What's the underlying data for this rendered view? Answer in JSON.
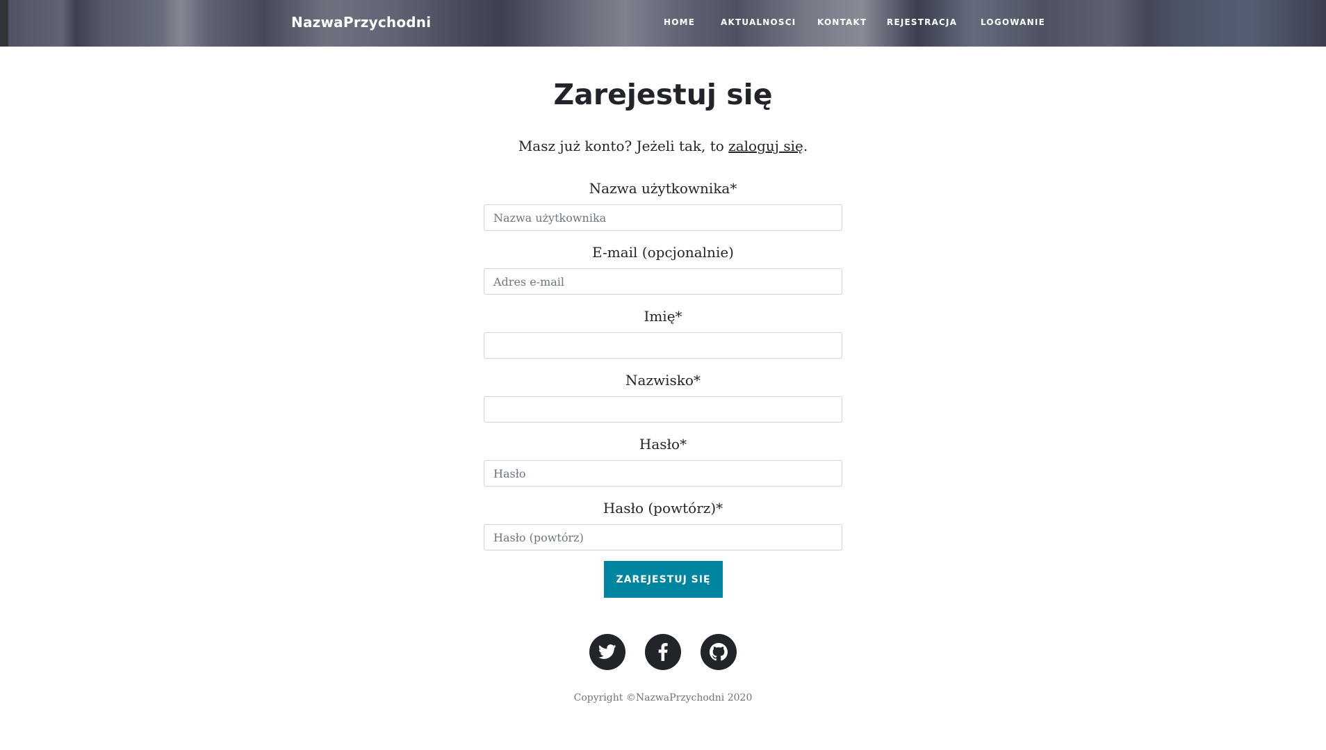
{
  "header": {
    "brand": "NazwaPrzychodni",
    "nav": [
      {
        "label": "HOME"
      },
      {
        "label": "AKTUALNOSCI"
      },
      {
        "label": "KONTAKT"
      },
      {
        "label": "REJESTRACJA"
      },
      {
        "label": "LOGOWANIE"
      }
    ]
  },
  "main": {
    "title": "Zarejestuj się",
    "subtitle_prefix": "Masz już konto? Jeżeli tak, to ",
    "subtitle_link": "zaloguj się",
    "subtitle_suffix": ".",
    "fields": [
      {
        "label": "Nazwa użytkownika*",
        "placeholder": "Nazwa użytkownika",
        "value": ""
      },
      {
        "label": "E-mail (opcjonalnie)",
        "placeholder": "Adres e-mail",
        "value": ""
      },
      {
        "label": "Imię*",
        "placeholder": "",
        "value": ""
      },
      {
        "label": "Nazwisko*",
        "placeholder": "",
        "value": ""
      },
      {
        "label": "Hasło*",
        "placeholder": "Hasło",
        "value": ""
      },
      {
        "label": "Hasło (powtórz)*",
        "placeholder": "Hasło (powtórz)",
        "value": ""
      }
    ],
    "submit_label": "ZAREJESTUJ SIĘ"
  },
  "footer": {
    "social": [
      {
        "icon": "twitter-icon"
      },
      {
        "icon": "facebook-icon"
      },
      {
        "icon": "github-icon"
      }
    ],
    "copyright": "Copyright ©NazwaPrzychodni 2020"
  },
  "colors": {
    "accent": "#0085a1",
    "text": "#212529",
    "muted": "#6c757d",
    "social_bg": "#212529"
  }
}
